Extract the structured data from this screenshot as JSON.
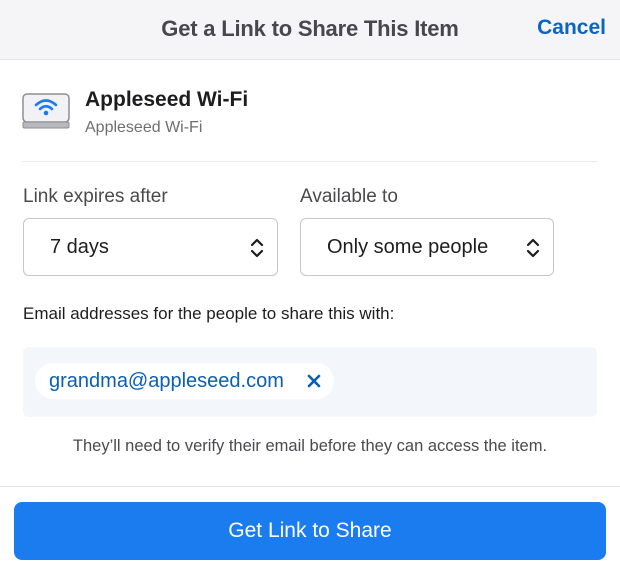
{
  "header": {
    "title": "Get a Link to Share This Item",
    "cancel_label": "Cancel"
  },
  "item": {
    "name": "Appleseed Wi-Fi",
    "subtitle": "Appleseed Wi-Fi",
    "icon": "wifi-router-icon"
  },
  "expires": {
    "label": "Link expires after",
    "value": "7 days"
  },
  "available": {
    "label": "Available to",
    "value": "Only some people"
  },
  "emails": {
    "label": "Email addresses for the people to share this with:",
    "tokens": [
      "grandma@appleseed.com"
    ]
  },
  "note": "They’ll need to verify their email before they can access the item.",
  "primary_button": "Get Link to Share",
  "colors": {
    "accent": "#1b7cf0",
    "link": "#0a66c2",
    "token_text": "#0a5fb4"
  }
}
